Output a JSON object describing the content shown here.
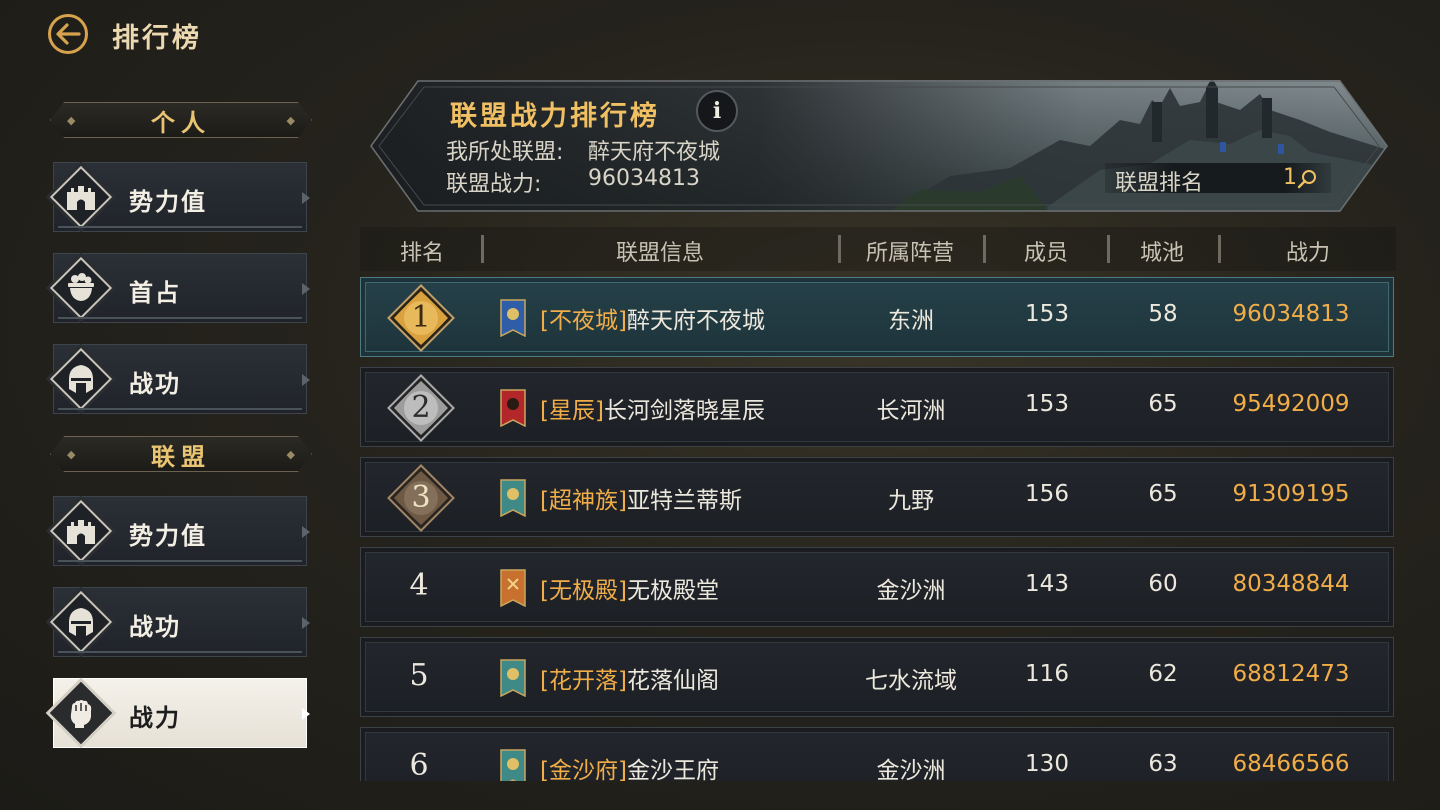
{
  "header": {
    "title": "排行榜",
    "back_icon": "back-arrow-icon"
  },
  "sidebar": {
    "sections": [
      {
        "label": "个人",
        "items": [
          {
            "label": "势力值",
            "icon": "fortress-icon",
            "active": false
          },
          {
            "label": "首占",
            "icon": "treasure-pot-icon",
            "active": false
          },
          {
            "label": "战功",
            "icon": "helmet-icon",
            "active": false
          }
        ]
      },
      {
        "label": "联盟",
        "items": [
          {
            "label": "势力值",
            "icon": "fortress-icon",
            "active": false
          },
          {
            "label": "战功",
            "icon": "helmet-icon",
            "active": false
          },
          {
            "label": "战力",
            "icon": "fist-icon",
            "active": true
          }
        ]
      }
    ]
  },
  "banner": {
    "title": "联盟战力排行榜",
    "info_icon": "info-icon",
    "my_alliance_label": "我所处联盟:",
    "my_alliance_value": "醉天府不夜城",
    "power_label": "联盟战力:",
    "power_value": "96034813",
    "rank_label": "联盟排名",
    "rank_value": "1"
  },
  "table": {
    "columns": [
      "排名",
      "联盟信息",
      "所属阵营",
      "成员",
      "城池",
      "战力"
    ],
    "rows": [
      {
        "rank": "1",
        "tag": "[不夜城]",
        "name": "醉天府不夜城",
        "camp": "东洲",
        "members": "153",
        "cities": "58",
        "power": "96034813",
        "flag_color": "#2f5da8",
        "mine": true
      },
      {
        "rank": "2",
        "tag": "[星辰]",
        "name": "长河剑落晓星辰",
        "camp": "长河洲",
        "members": "153",
        "cities": "65",
        "power": "95492009",
        "flag_color": "#b3262a",
        "mine": false
      },
      {
        "rank": "3",
        "tag": "[超神族]",
        "name": "亚特兰蒂斯",
        "camp": "九野",
        "members": "156",
        "cities": "65",
        "power": "91309195",
        "flag_color": "#3f8a86",
        "mine": false
      },
      {
        "rank": "4",
        "tag": "[无极殿]",
        "name": "无极殿堂",
        "camp": "金沙洲",
        "members": "143",
        "cities": "60",
        "power": "80348844",
        "flag_color": "#c8702e",
        "mine": false
      },
      {
        "rank": "5",
        "tag": "[花开落]",
        "name": "花落仙阁",
        "camp": "七水流域",
        "members": "116",
        "cities": "62",
        "power": "68812473",
        "flag_color": "#3f8a86",
        "mine": false
      },
      {
        "rank": "6",
        "tag": "[金沙府]",
        "name": "金沙王府",
        "camp": "金沙洲",
        "members": "130",
        "cities": "63",
        "power": "68466566",
        "flag_color": "#3f8a86",
        "mine": false
      }
    ]
  }
}
